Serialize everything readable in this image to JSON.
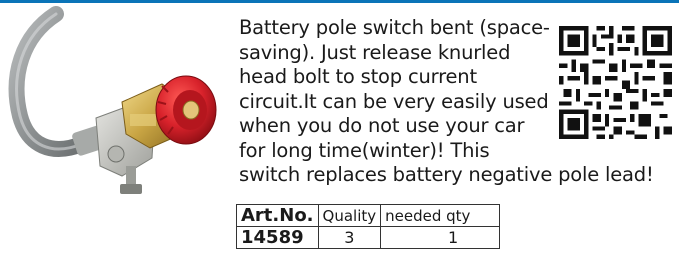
{
  "description": {
    "lines": [
      "Battery pole switch bent (space-",
      "saving). Just release knurled",
      "head bolt to stop current",
      "circuit.It can be very easily used",
      "when you do not use your car",
      "for long time(winter)! This",
      "switch replaces battery negative pole lead!"
    ]
  },
  "table": {
    "headers": [
      "Art.No.",
      "Quality",
      "needed qty"
    ],
    "row": [
      "14589",
      "3",
      "1"
    ]
  },
  "colors": {
    "accent_rule": "#0a74b8",
    "knob_red": "#d8222b",
    "brass": "#c9a544",
    "cable_gray": "#8c8f90"
  }
}
